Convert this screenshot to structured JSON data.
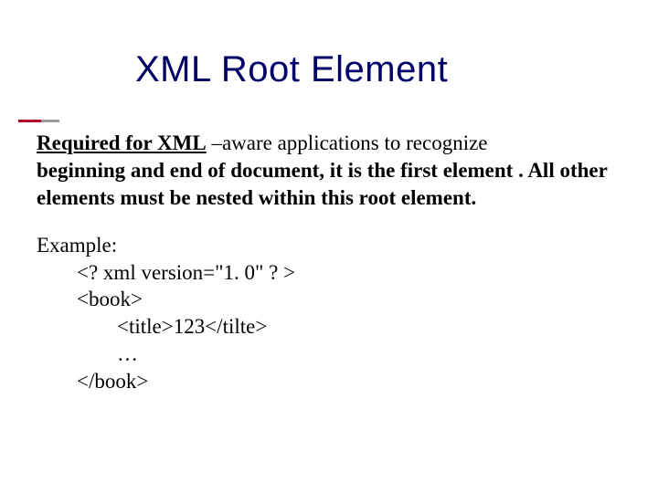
{
  "title": "XML Root Element",
  "para1": {
    "lead": "Required for XML",
    "tail_plain": " –aware applications to recognize ",
    "rest_bold": "beginning and end of document, it is the first element . All other elements must be nested within this root element."
  },
  "example": {
    "label": "Example:",
    "line1": "<? xml version=\"1. 0\" ? >",
    "line2": "<book>",
    "line3": "<title>123</tilte>",
    "line4": "…",
    "line5": "</book>"
  }
}
